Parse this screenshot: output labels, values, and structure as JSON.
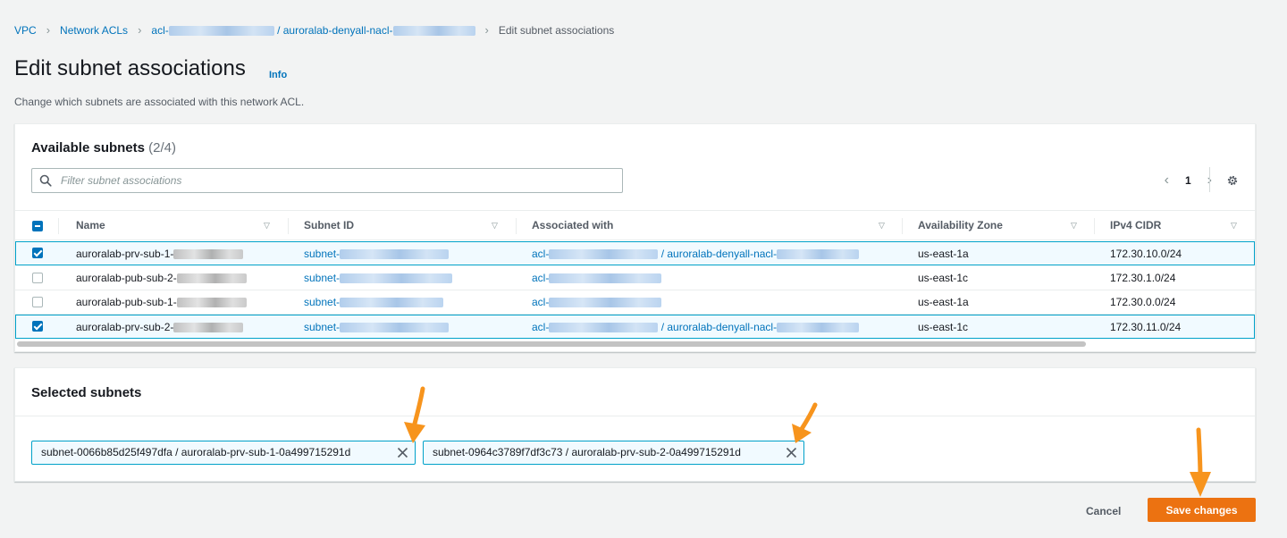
{
  "breadcrumb": {
    "items": [
      "VPC",
      "Network ACLs"
    ],
    "acl_prefix": "acl-",
    "acl_name_prefix": "/ auroralab-denyall-nacl-",
    "current": "Edit subnet associations"
  },
  "page": {
    "title": "Edit subnet associations",
    "info": "Info",
    "description": "Change which subnets are associated with this network ACL."
  },
  "available": {
    "title": "Available subnets",
    "count": "(2/4)",
    "filter_placeholder": "Filter subnet associations",
    "page": "1",
    "columns": [
      "Name",
      "Subnet ID",
      "Associated with",
      "Availability Zone",
      "IPv4 CIDR"
    ],
    "rows": [
      {
        "name": "auroralab-prv-sub-1-",
        "subnet": "subnet-",
        "assoc": "acl-",
        "assoc_suffix": "/ auroralab-denyall-nacl-",
        "az": "us-east-1a",
        "cidr": "172.30.10.0/24",
        "checked": true
      },
      {
        "name": "auroralab-pub-sub-2-",
        "subnet": "subnet-",
        "assoc": "acl-",
        "assoc_suffix": "",
        "az": "us-east-1c",
        "cidr": "172.30.1.0/24",
        "checked": false
      },
      {
        "name": "auroralab-pub-sub-1-",
        "subnet": "subnet-",
        "assoc": "acl-",
        "assoc_suffix": "",
        "az": "us-east-1a",
        "cidr": "172.30.0.0/24",
        "checked": false
      },
      {
        "name": "auroralab-prv-sub-2-",
        "subnet": "subnet-",
        "assoc": "acl-",
        "assoc_suffix": "/ auroralab-denyall-nacl-",
        "az": "us-east-1c",
        "cidr": "172.30.11.0/24",
        "checked": true
      }
    ]
  },
  "selected": {
    "title": "Selected subnets",
    "tokens": [
      "subnet-0066b85d25f497dfa / auroralab-prv-sub-1-0a499715291d",
      "subnet-0964c3789f7df3c73 / auroralab-prv-sub-2-0a499715291d"
    ]
  },
  "actions": {
    "cancel": "Cancel",
    "save": "Save changes"
  },
  "colors": {
    "accent": "#ec7211",
    "link": "#0073bb",
    "annotation_arrow": "#f7941d"
  }
}
